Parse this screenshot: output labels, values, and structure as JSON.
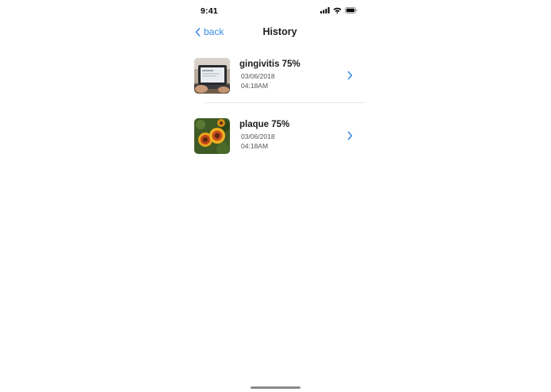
{
  "status_bar": {
    "time": "9:41",
    "icons": [
      "cellular-signal-icon",
      "wifi-icon",
      "battery-icon"
    ]
  },
  "nav": {
    "back_label": "back",
    "title": "History",
    "accent_color": "#3b8be6"
  },
  "history": {
    "items": [
      {
        "title": "gingivitis 75%",
        "date": "03/06/2018",
        "time": "04:18AM",
        "thumbnail": "laptop-photo"
      },
      {
        "title": "plaque 75%",
        "date": "03/06/2018",
        "time": "04:18AM",
        "thumbnail": "flower-photo"
      }
    ]
  }
}
